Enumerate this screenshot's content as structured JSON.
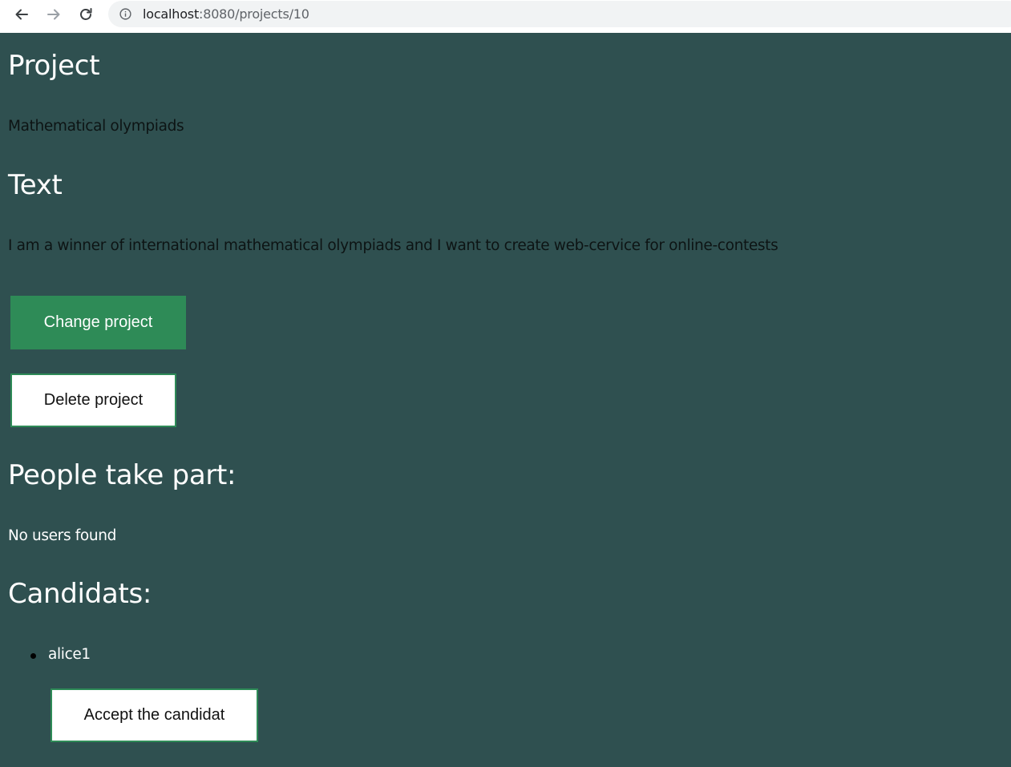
{
  "browser": {
    "url_host": "localhost",
    "url_rest": ":8080/projects/10"
  },
  "project": {
    "heading": "Project",
    "name": "Mathematical olympiads"
  },
  "text_section": {
    "heading": "Text",
    "body": "I am a winner of international mathematical olympiads and I want to create web-cervice for online-contests"
  },
  "actions": {
    "change_label": "Change project",
    "delete_label": "Delete project"
  },
  "participants": {
    "heading": "People take part:",
    "empty_text": "No users found"
  },
  "candidates": {
    "heading": "Candidats:",
    "items": [
      {
        "name": "alice1",
        "accept_label": "Accept the candidat"
      }
    ]
  },
  "colors": {
    "background": "#2f5050",
    "accent": "#2e8b57"
  }
}
